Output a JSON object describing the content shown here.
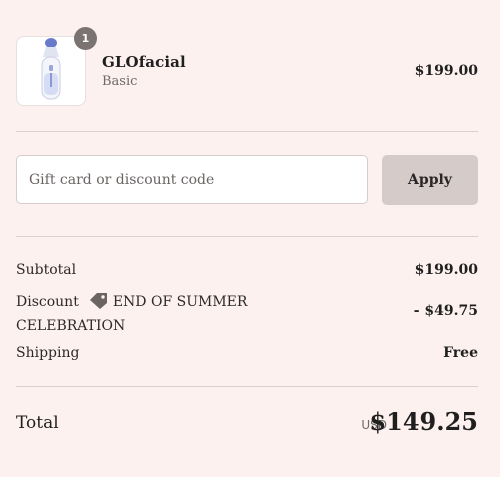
{
  "line_item": {
    "name": "GLOfacial",
    "variant": "Basic",
    "price": "$199.00",
    "quantity": "1",
    "image_icon": "facial-device-image"
  },
  "discount": {
    "placeholder": "Gift card or discount code",
    "value": "",
    "apply_label": "Apply"
  },
  "summary": {
    "subtotal_label": "Subtotal",
    "subtotal_value": "$199.00",
    "discount_label": "Discount",
    "discount_code": "END OF SUMMER CELEBRATION",
    "discount_icon": "tag-icon",
    "discount_value": "- $49.75",
    "shipping_label": "Shipping",
    "shipping_value": "Free",
    "total_label": "Total",
    "currency": "USD",
    "total_value": "$149.25"
  },
  "colors": {
    "background": "#fcf1ef",
    "apply_button": "#d5cbc9",
    "badge": "#7a7372",
    "divider": "#d9cfcd"
  }
}
